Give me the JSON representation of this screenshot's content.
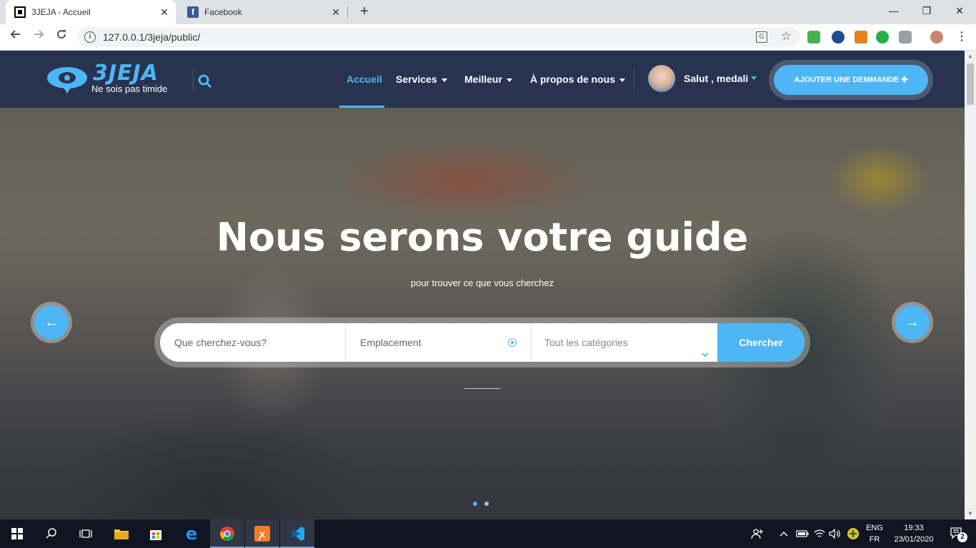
{
  "browser": {
    "tabs": [
      {
        "title": "3JEJA - Accueil",
        "favicon": "3jeja-favicon-icon",
        "active": true
      },
      {
        "title": "Facebook",
        "favicon": "facebook-icon",
        "active": false
      }
    ],
    "tab_close_glyph": "✕",
    "new_tab_glyph": "+",
    "address": "127.0.0.1/3jeja/public/",
    "window_controls": {
      "minimize": "—",
      "maximize": "❐",
      "close": "✕"
    }
  },
  "header": {
    "logo": {
      "brand": "3JEJA",
      "tagline": "Ne sois pas timide"
    },
    "menu": [
      {
        "label": "Accueil",
        "active": true,
        "has_caret": false
      },
      {
        "label": "Services",
        "active": false,
        "has_caret": true
      },
      {
        "label": "Meilleur",
        "active": false,
        "has_caret": true
      },
      {
        "label": "À propos de nous",
        "active": false,
        "has_caret": true
      }
    ],
    "user": {
      "greeting": "Salut , medali"
    },
    "cta": {
      "label": "AJOUTER UNE DEMMANDE ✚"
    }
  },
  "hero": {
    "title": "Nous serons votre guide",
    "subtitle": "pour trouver ce que vous cherchez",
    "search": {
      "what_placeholder": "Que cherchez-vous?",
      "location_placeholder": "Emplacement",
      "category_value": "Tout les catégories",
      "button": "Chercher"
    },
    "prev_glyph": "←",
    "next_glyph": "→",
    "slides_total": 2,
    "slide_active": 1
  },
  "taskbar": {
    "lang_top": "ENG",
    "lang_bottom": "FR",
    "time": "19:33",
    "date": "23/01/2020",
    "notifications": "2"
  },
  "colors": {
    "accent": "#4db6f5",
    "header_bg": "#283350",
    "taskbar_bg": "#101521"
  }
}
